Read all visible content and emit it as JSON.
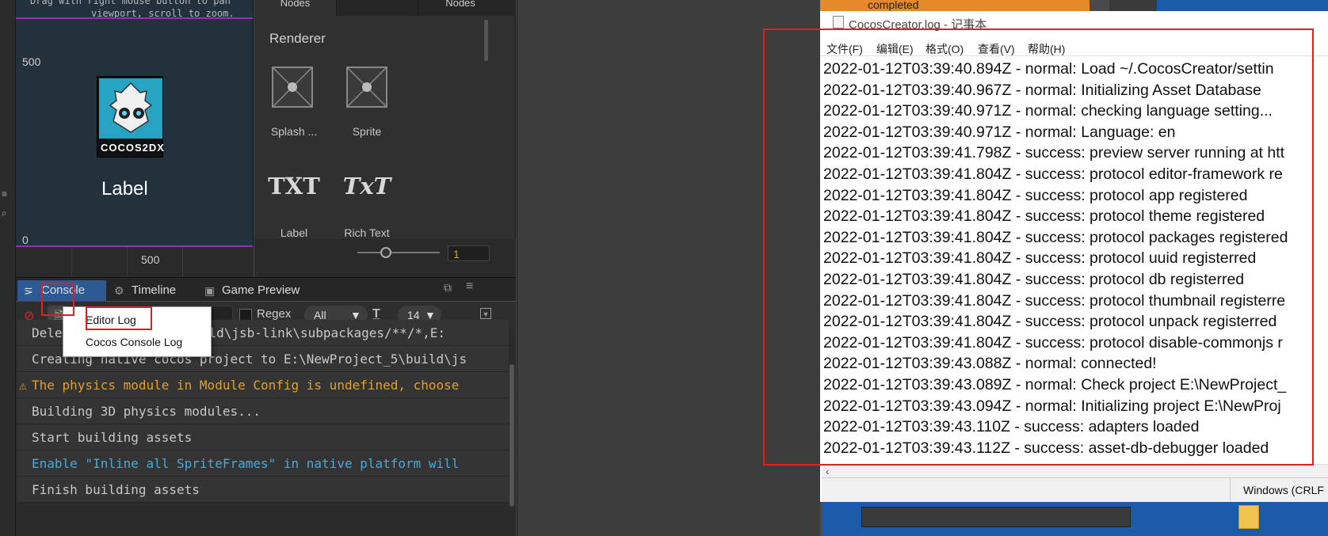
{
  "scene": {
    "hint_line1": "Drag with right mouse button to pan",
    "hint_line2": "viewport, scroll to zoom.",
    "axis_500_left": "500",
    "axis_0": "0",
    "axis_500_bottom": "500",
    "label_text": "Label",
    "logo_text": "COCOS2DX"
  },
  "assets": {
    "tabs": [
      "Nodes",
      "",
      "Nodes"
    ],
    "section_title": "Renderer",
    "items": [
      {
        "label": "Splash ...",
        "icon": "splash-icon"
      },
      {
        "label": "Sprite",
        "icon": "sprite-icon"
      },
      {
        "label": "Label",
        "icon": "txt-icon",
        "glyph": "TXT"
      },
      {
        "label": "Rich Text",
        "icon": "rich-text-icon",
        "glyph": "TxT"
      }
    ],
    "zoom_value": "1",
    "zoom_level": 0.35
  },
  "console": {
    "tabs": [
      {
        "label": "Console",
        "icon": "console-icon"
      },
      {
        "label": "Timeline",
        "icon": "timeline-icon"
      },
      {
        "label": "Game Preview",
        "icon": "game-preview-icon"
      }
    ],
    "regex_label": "Regex",
    "filter_selected": "All",
    "font_size": "14",
    "dropdown_menu": {
      "items": [
        "Editor Log",
        "Cocos Console Log"
      ]
    },
    "logs": [
      {
        "text": "Dele",
        "suffix": "build\\jsb-link\\subpackages/**/*,E:",
        "type": "normal"
      },
      {
        "text": "Creating native cocos project to E:\\NewProject_5\\build\\js",
        "type": "normal"
      },
      {
        "text": "The physics module in Module Config is undefined, choose",
        "type": "warning"
      },
      {
        "text": "Building 3D physics modules...",
        "type": "normal"
      },
      {
        "text": "Start building assets",
        "type": "normal"
      },
      {
        "text": "Enable \"Inline all SpriteFrames\" in native platform will",
        "type": "info"
      },
      {
        "text": "Finish building assets",
        "type": "normal"
      }
    ],
    "colors": {
      "warning": "#e0a030",
      "info": "#4aa8d8",
      "normal": "#c8c8c8"
    }
  },
  "notepad": {
    "title": "CocosCreator.log - 记事本",
    "menu": [
      "文件(F)",
      "编辑(E)",
      "格式(O)",
      "查看(V)",
      "帮助(H)"
    ],
    "lines": [
      "2022-01-12T03:39:40.894Z - normal: Load ~/.CocosCreator/settin",
      "2022-01-12T03:39:40.967Z - normal: Initializing Asset Database",
      "2022-01-12T03:39:40.971Z - normal: checking language setting...",
      "2022-01-12T03:39:40.971Z - normal: Language: en",
      "2022-01-12T03:39:41.798Z - success: preview server running at htt",
      "2022-01-12T03:39:41.804Z - success: protocol editor-framework re",
      "2022-01-12T03:39:41.804Z - success: protocol app registered",
      "2022-01-12T03:39:41.804Z - success: protocol theme registered",
      "2022-01-12T03:39:41.804Z - success: protocol packages registered",
      "2022-01-12T03:39:41.804Z - success: protocol uuid registerred",
      "2022-01-12T03:39:41.804Z - success: protocol db registerred",
      "2022-01-12T03:39:41.804Z - success: protocol thumbnail registerre",
      "2022-01-12T03:39:41.804Z - success: protocol unpack registerred",
      "2022-01-12T03:39:41.804Z - success: protocol disable-commonjs r",
      "2022-01-12T03:39:43.088Z - normal: connected!",
      "2022-01-12T03:39:43.089Z - normal: Check project E:\\NewProject_",
      "2022-01-12T03:39:43.094Z - normal: Initializing project E:\\NewProj",
      "2022-01-12T03:39:43.110Z - success: adapters loaded",
      "2022-01-12T03:39:43.112Z - success: asset-db-debugger loaded"
    ],
    "status_encoding": "Windows (CRLF"
  },
  "taskbar": {
    "completed_label": "completed"
  }
}
